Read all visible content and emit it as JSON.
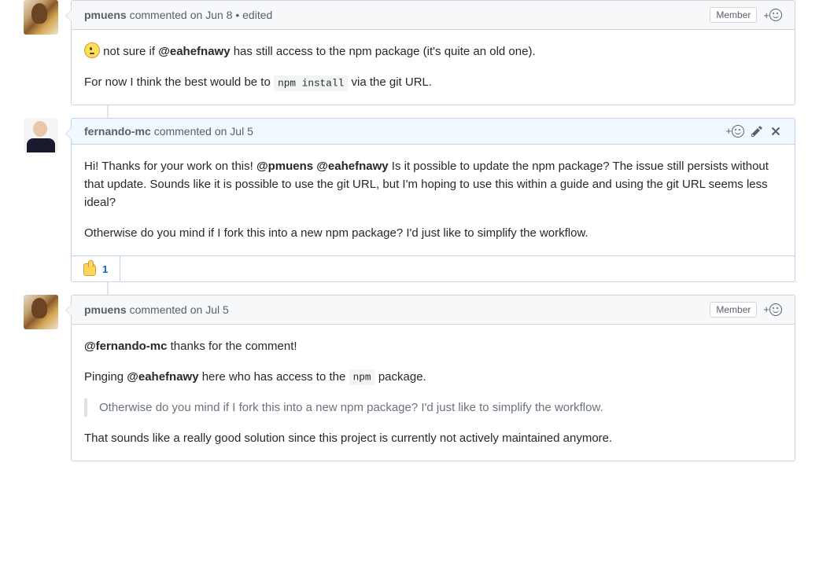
{
  "common": {
    "member_badge": "Member",
    "edited_suffix": "• edited"
  },
  "comments": [
    {
      "author": "pmuens",
      "action": "commented",
      "timestamp": "on Jun 8",
      "edited": true,
      "is_member": true,
      "body": {
        "p1_prefix": "not sure if ",
        "p1_mention": "@eahefnawy",
        "p1_suffix": " has still access to the npm package (it's quite an old one).",
        "p2_prefix": "For now I think the best would be to ",
        "p2_code": "npm install",
        "p2_suffix": " via the git URL."
      }
    },
    {
      "author": "fernando-mc",
      "action": "commented",
      "timestamp": "on Jul 5",
      "body": {
        "p1_a": "Hi! Thanks for your work on this! ",
        "p1_m1": "@pmuens",
        "p1_b": " ",
        "p1_m2": "@eahefnawy",
        "p1_c": " Is it possible to update the npm package? The issue still persists without that update. Sounds like it is possible to use the git URL, but I'm hoping to use this within a guide and using the git URL seems less ideal?",
        "p2": "Otherwise do you mind if I fork this into a new npm package? I'd just like to simplify the workflow."
      },
      "reactions": {
        "thumbs_up": "1"
      }
    },
    {
      "author": "pmuens",
      "action": "commented",
      "timestamp": "on Jul 5",
      "is_member": true,
      "body": {
        "p1_m": "@fernando-mc",
        "p1_s": " thanks for the comment!",
        "p2_a": "Pinging ",
        "p2_m": "@eahefnawy",
        "p2_b": " here who has access to the ",
        "p2_code": "npm",
        "p2_c": " package.",
        "quote": "Otherwise do you mind if I fork this into a new npm package? I'd just like to simplify the workflow.",
        "p3": "That sounds like a really good solution since this project is currently not actively maintained anymore."
      }
    }
  ]
}
